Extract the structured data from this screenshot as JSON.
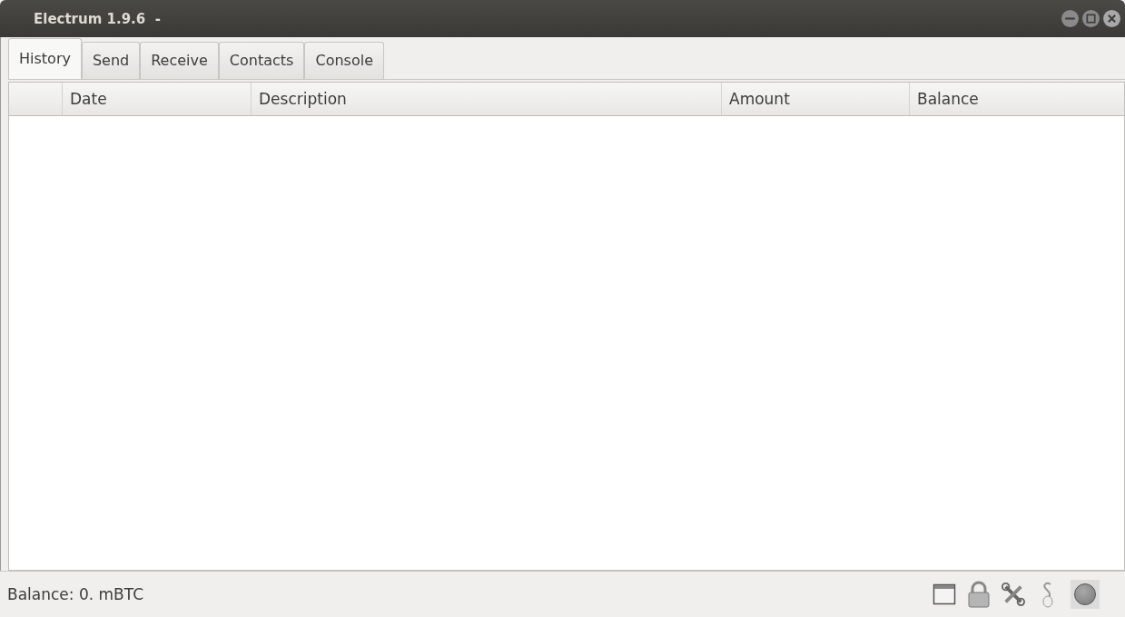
{
  "window": {
    "title": "Electrum 1.9.6  -"
  },
  "tabs": [
    {
      "label": "History",
      "selected": true
    },
    {
      "label": "Send",
      "selected": false
    },
    {
      "label": "Receive",
      "selected": false
    },
    {
      "label": "Contacts",
      "selected": false
    },
    {
      "label": "Console",
      "selected": false
    }
  ],
  "table": {
    "columns": [
      "",
      "Date",
      "Description",
      "Amount",
      "Balance"
    ]
  },
  "status_bar": {
    "balance": "Balance: 0. mBTC"
  }
}
